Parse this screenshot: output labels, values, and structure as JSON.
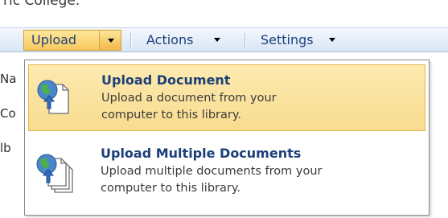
{
  "header": {
    "partial_text": "ric College."
  },
  "toolbar": {
    "upload_label": "Upload",
    "actions_label": "Actions",
    "settings_label": "Settings"
  },
  "left_strip": [
    "Na",
    "Co",
    "lb"
  ],
  "upload_menu": {
    "items": [
      {
        "title": "Upload Document",
        "description_line1": "Upload a document from your",
        "description_line2": "computer to this library.",
        "icon": "upload-document-icon"
      },
      {
        "title": "Upload Multiple Documents",
        "description_line1": "Upload multiple documents from your",
        "description_line2": "computer to this library.",
        "icon": "upload-multiple-documents-icon"
      }
    ]
  },
  "colors": {
    "highlight": "#fbe09f",
    "link_blue": "#1c3f7a",
    "toolbar_top": "#f4f8fd",
    "toolbar_bottom": "#d9e6f5"
  }
}
